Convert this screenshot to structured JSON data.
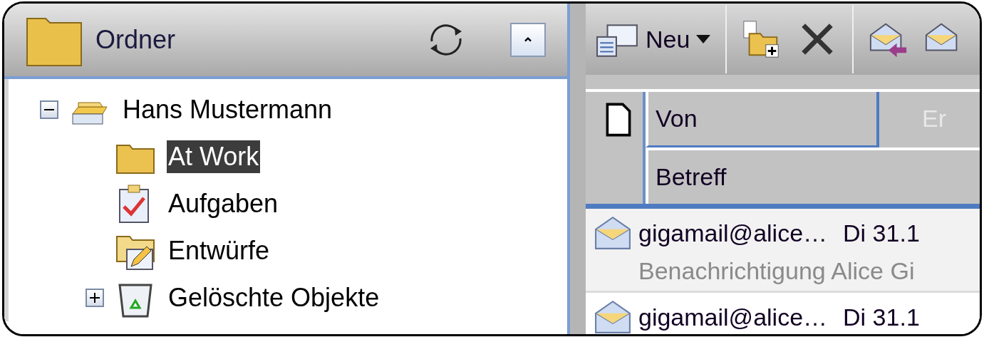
{
  "folder_pane": {
    "title": "Ordner",
    "tree": [
      {
        "label": "Hans Mustermann",
        "kind": "account",
        "expanded": true,
        "selected": false,
        "children": [
          {
            "label": "At Work",
            "kind": "folder",
            "selected": true
          },
          {
            "label": "Aufgaben",
            "kind": "tasks",
            "selected": false
          },
          {
            "label": "Entwürfe",
            "kind": "drafts",
            "selected": false
          },
          {
            "label": "Gelöschte Objekte",
            "kind": "trash",
            "expanded": false,
            "selected": false
          }
        ]
      }
    ]
  },
  "message_pane": {
    "toolbar": {
      "new_button": "Neu"
    },
    "columns": [
      {
        "label": "Von"
      },
      {
        "label": "Er"
      }
    ],
    "second_row_column": "Betreff",
    "messages": [
      {
        "from": "gigamail@alice…",
        "date": "Di 31.1",
        "subject": "Benachrichtigung Alice Gi",
        "selected": true
      },
      {
        "from": "gigamail@alice…",
        "date": "Di 31.1",
        "selected": false
      }
    ]
  }
}
